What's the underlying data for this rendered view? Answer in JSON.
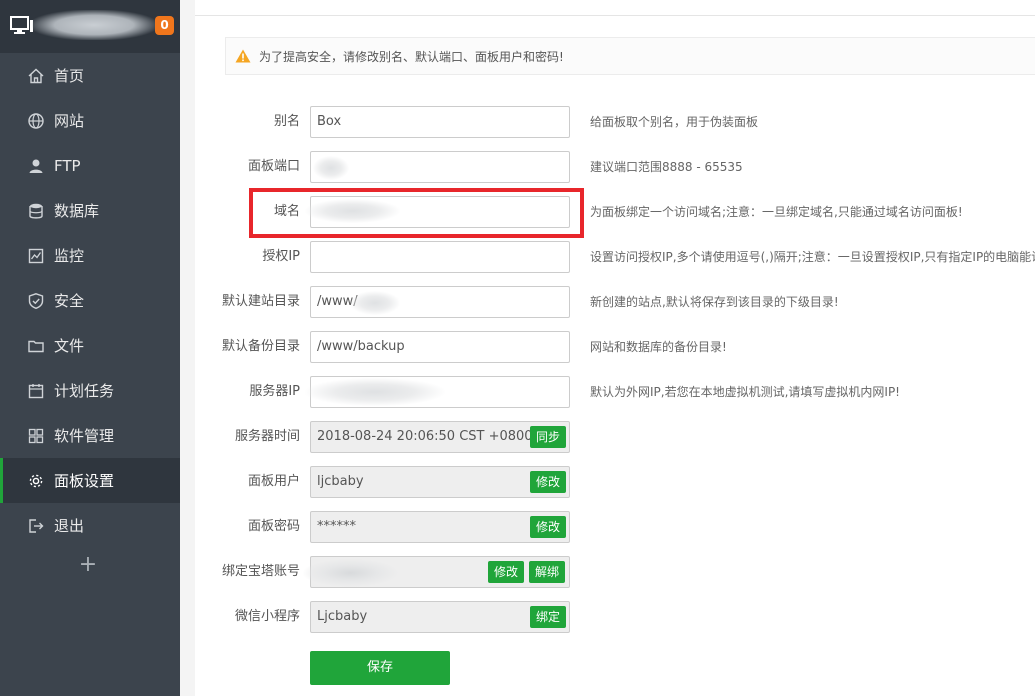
{
  "sidebar": {
    "badge": "0",
    "add_label": "+",
    "items": [
      {
        "label": "首页",
        "icon": "home-icon"
      },
      {
        "label": "网站",
        "icon": "globe-icon"
      },
      {
        "label": "FTP",
        "icon": "ftp-user-icon"
      },
      {
        "label": "数据库",
        "icon": "database-icon"
      },
      {
        "label": "监控",
        "icon": "monitor-chart-icon"
      },
      {
        "label": "安全",
        "icon": "shield-icon"
      },
      {
        "label": "文件",
        "icon": "folder-icon"
      },
      {
        "label": "计划任务",
        "icon": "calendar-icon"
      },
      {
        "label": "软件管理",
        "icon": "grid-icon"
      },
      {
        "label": "面板设置",
        "icon": "gear-icon"
      },
      {
        "label": "退出",
        "icon": "logout-icon"
      }
    ],
    "active_index": 9
  },
  "alert": {
    "text": "为了提高安全，请修改别名、默认端口、面板用户和密码!"
  },
  "form": {
    "alias": {
      "label": "别名",
      "value": "Box",
      "hint": "给面板取个别名，用于伪装面板"
    },
    "port": {
      "label": "面板端口",
      "value": "",
      "hint": "建议端口范围8888 - 65535"
    },
    "domain": {
      "label": "域名",
      "value": "",
      "hint": "为面板绑定一个访问域名;注意：一旦绑定域名,只能通过域名访问面板!"
    },
    "auth_ip": {
      "label": "授权IP",
      "value": "",
      "hint": "设置访问授权IP,多个请使用逗号(,)隔开;注意：一旦设置授权IP,只有指定IP的电脑能访问面板!"
    },
    "site_dir": {
      "label": "默认建站目录",
      "value": "/www/",
      "hint": "新创建的站点,默认将保存到该目录的下级目录!"
    },
    "backup_dir": {
      "label": "默认备份目录",
      "value": "/www/backup",
      "hint": "网站和数据库的备份目录!"
    },
    "server_ip": {
      "label": "服务器IP",
      "value": "",
      "hint": "默认为外网IP,若您在本地虚拟机测试,请填写虚拟机内网IP!"
    },
    "server_time": {
      "label": "服务器时间",
      "value": "2018-08-24 20:06:50 CST +0800",
      "button": "同步"
    },
    "panel_user": {
      "label": "面板用户",
      "value": "ljcbaby",
      "button": "修改"
    },
    "panel_pass": {
      "label": "面板密码",
      "value": "******",
      "button": "修改"
    },
    "bt_account": {
      "label": "绑定宝塔账号",
      "value": "",
      "button_edit": "修改",
      "button_unbind": "解绑"
    },
    "wechat": {
      "label": "微信小程序",
      "value": "Ljcbaby",
      "button": "绑定"
    },
    "save_label": "保存"
  },
  "colors": {
    "sidebar_bg": "#3c444d",
    "accent_green": "#20a53a",
    "badge_orange": "#f0761c",
    "highlight_red": "#e8262b"
  }
}
